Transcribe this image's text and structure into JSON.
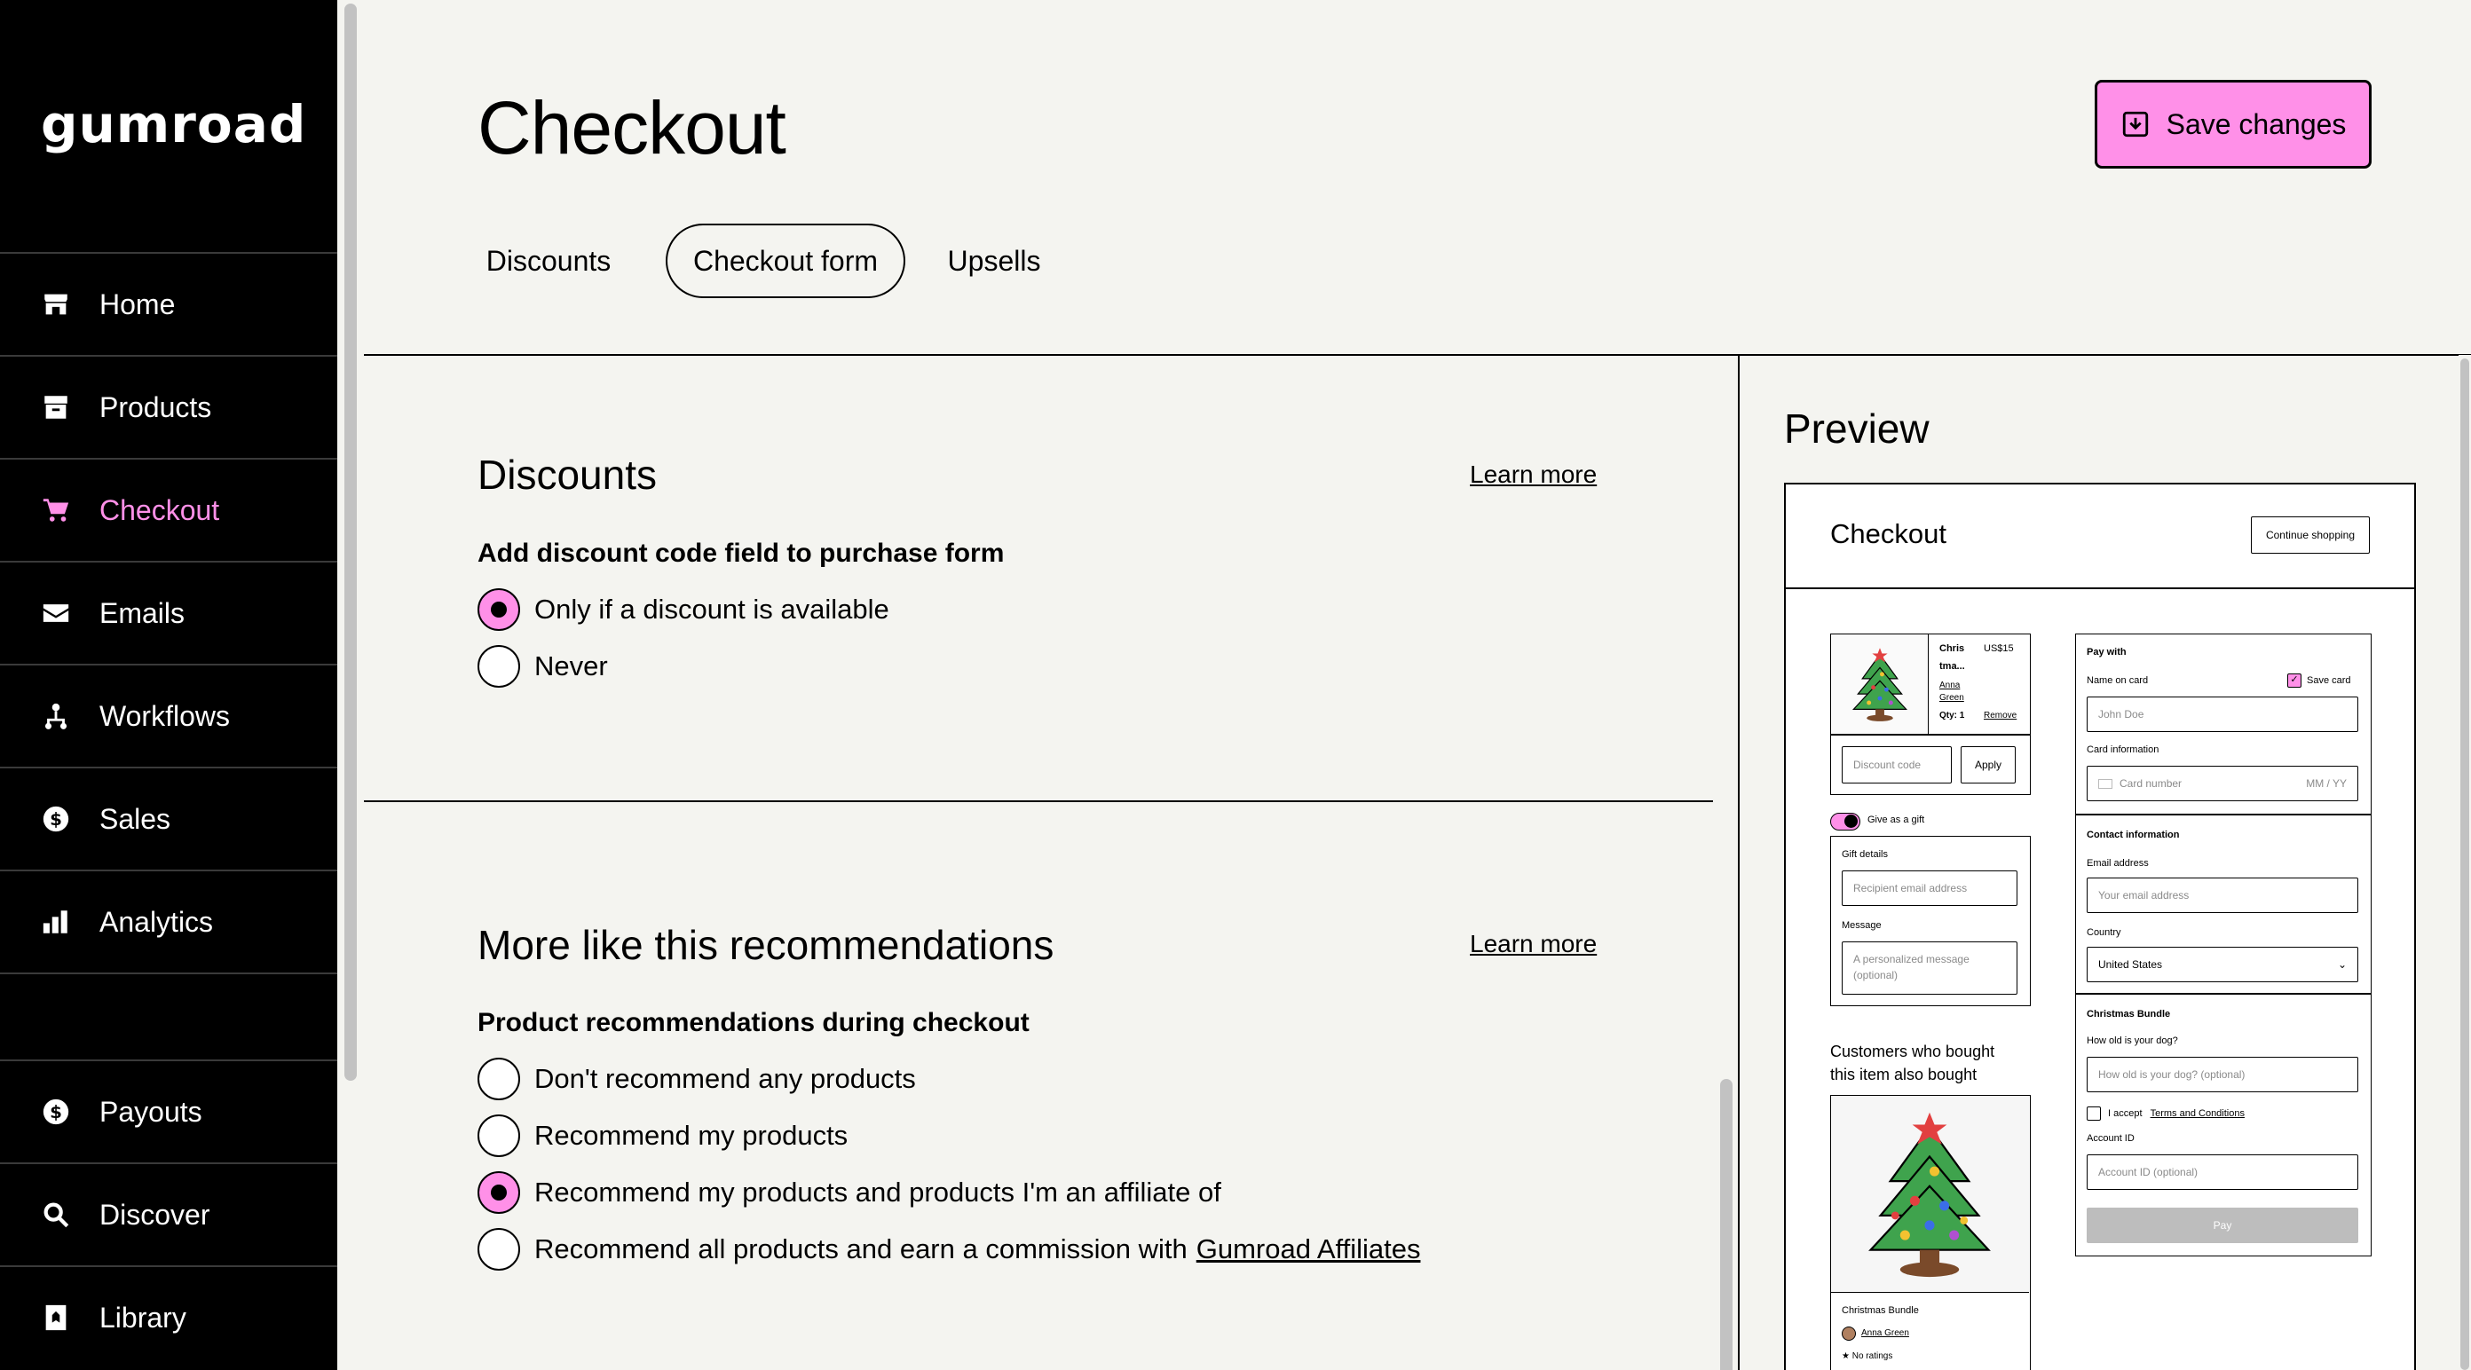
{
  "sidebar": {
    "logo": "Gumroad",
    "items": [
      {
        "label": "Home",
        "icon": "store-icon"
      },
      {
        "label": "Products",
        "icon": "archive-icon"
      },
      {
        "label": "Checkout",
        "icon": "cart-icon",
        "active": true
      },
      {
        "label": "Emails",
        "icon": "envelope-icon"
      },
      {
        "label": "Workflows",
        "icon": "workflow-icon"
      },
      {
        "label": "Sales",
        "icon": "dollar-circle-icon"
      },
      {
        "label": "Analytics",
        "icon": "bar-chart-icon"
      },
      {
        "label": "Payouts",
        "icon": "dollar-circle-icon"
      },
      {
        "label": "Discover",
        "icon": "search-icon"
      },
      {
        "label": "Library",
        "icon": "bookmark-icon"
      }
    ]
  },
  "header": {
    "title": "Checkout",
    "save_label": "Save changes",
    "tabs": [
      {
        "label": "Discounts"
      },
      {
        "label": "Checkout form",
        "active": true
      },
      {
        "label": "Upsells"
      }
    ]
  },
  "discounts": {
    "title": "Discounts",
    "learn_more": "Learn more",
    "field_label": "Add discount code field to purchase form",
    "options": [
      {
        "label": "Only if a discount is available",
        "checked": true
      },
      {
        "label": "Never",
        "checked": false
      }
    ]
  },
  "recommendations": {
    "title": "More like this recommendations",
    "learn_more": "Learn more",
    "field_label": "Product recommendations during checkout",
    "options": [
      {
        "label": "Don't recommend any products",
        "checked": false
      },
      {
        "label": "Recommend my products",
        "checked": false
      },
      {
        "label": "Recommend my products and products I'm an affiliate of",
        "checked": true
      },
      {
        "label": "Recommend all products and earn a commission with",
        "link": "Gumroad Affiliates",
        "checked": false
      }
    ]
  },
  "preview": {
    "title": "Preview",
    "checkout_title": "Checkout",
    "continue_shopping": "Continue shopping",
    "cart_item": {
      "name_line1": "Chris",
      "name_line2": "tma...",
      "creator_line1": "Anna",
      "creator_line2": "Green",
      "qty": "Qty: 1",
      "price": "US$15",
      "remove": "Remove"
    },
    "discount_placeholder": "Discount code",
    "apply": "Apply",
    "gift_toggle": "Give as a gift",
    "gift_details": "Gift details",
    "recipient_placeholder": "Recipient email address",
    "message_label": "Message",
    "message_placeholder_1": "A personalized message",
    "message_placeholder_2": "(optional)",
    "also_bought_1": "Customers who bought",
    "also_bought_2": "this item also bought",
    "rec_product": "Christmas Bundle",
    "rec_creator": "Anna Green",
    "rec_rating": "No ratings",
    "pay_with": "Pay with",
    "name_on_card": "Name on card",
    "save_card": "Save card",
    "name_placeholder": "John Doe",
    "card_info": "Card information",
    "card_number_placeholder": "Card number",
    "card_expiry_placeholder": "MM / YY",
    "contact_info": "Contact information",
    "email_label": "Email address",
    "email_placeholder": "Your email address",
    "country_label": "Country",
    "country_value": "United States",
    "bundle_title": "Christmas Bundle",
    "dog_question": "How old is your dog?",
    "dog_placeholder": "How old is your dog? (optional)",
    "accept_prefix": "I accept",
    "terms_link": "Terms and Conditions",
    "account_id_label": "Account ID",
    "account_id_placeholder": "Account ID (optional)",
    "pay_button": "Pay"
  },
  "colors": {
    "accent": "#ff90e8",
    "background": "#f4f4f0",
    "sidebar": "#000000"
  }
}
